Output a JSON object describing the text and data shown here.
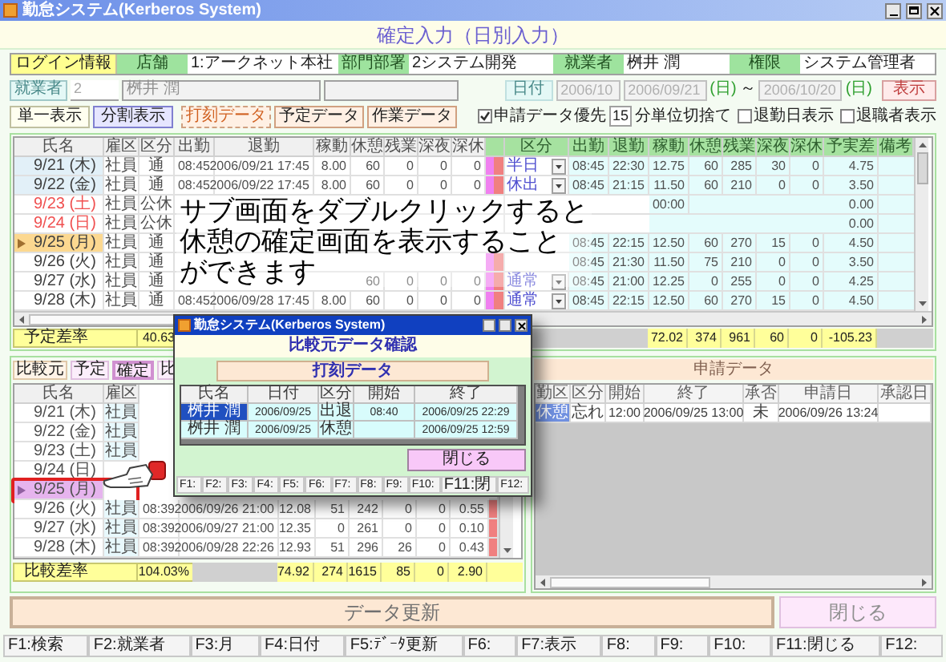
{
  "window": {
    "title": "勤怠システム(Kerberos System)"
  },
  "heading": "確定入力（日別入力）",
  "login_info": {
    "label": "ログイン情報",
    "fields": [
      {
        "label": "店舗",
        "value": "1:アークネット本社"
      },
      {
        "label": "部門部署",
        "value": "2システム開発"
      },
      {
        "label": "就業者",
        "value": "桝井 潤"
      },
      {
        "label": "権限",
        "value": "システム管理者"
      }
    ]
  },
  "filter": {
    "employee_button": "就業者",
    "employee_code": "2",
    "employee_name": "桝井 潤",
    "date_label": "日付",
    "month": "2006/10",
    "date_from": "2006/09/21",
    "weekday_from": "(日)",
    "range_sep": "～",
    "date_to": "2006/10/20",
    "weekday_to": "(日)",
    "show_button": "表示"
  },
  "view_buttons": [
    {
      "label": "単一表示",
      "selected": false
    },
    {
      "label": "分割表示",
      "selected": true
    }
  ],
  "data_buttons": [
    {
      "label": "打刻データ"
    },
    {
      "label": "予定データ"
    },
    {
      "label": "作業データ"
    }
  ],
  "options": [
    {
      "kind": "checkbox",
      "label": "申請データ優先",
      "checked": true
    },
    {
      "kind": "field",
      "value": "15"
    },
    {
      "kind": "text",
      "label": "分単位切捨て"
    },
    {
      "kind": "checkbox",
      "label": "退勤日表示",
      "checked": false
    },
    {
      "kind": "checkbox",
      "label": "退職者表示",
      "checked": false
    }
  ],
  "daily_table": {
    "columns": [
      {
        "label": "氏名",
        "kind": "name"
      },
      {
        "label": "雇区",
        "kind": "label"
      },
      {
        "label": "区分",
        "kind": "label"
      },
      {
        "label": "出勤",
        "kind": "number"
      },
      {
        "label": "退勤",
        "kind": "number"
      },
      {
        "label": "稼動",
        "kind": "number"
      },
      {
        "label": "休憩",
        "kind": "number"
      },
      {
        "label": "残業",
        "kind": "number"
      },
      {
        "label": "深夜",
        "kind": "number"
      },
      {
        "label": "深休",
        "kind": "number"
      },
      {
        "kind": "flags"
      },
      {
        "label": "区分",
        "kind": "select"
      },
      {
        "label": "出勤",
        "kind": "number"
      },
      {
        "label": "退勤",
        "kind": "number"
      },
      {
        "label": "稼動",
        "kind": "number"
      },
      {
        "label": "休憩",
        "kind": "number"
      },
      {
        "label": "残業",
        "kind": "number"
      },
      {
        "label": "深夜",
        "kind": "number"
      },
      {
        "label": "深休",
        "kind": "number"
      },
      {
        "label": "予実差",
        "kind": "number"
      },
      {
        "label": "備考",
        "kind": "number"
      }
    ],
    "rows": [
      {
        "selected": false,
        "holiday": false,
        "shaded": true,
        "flags": true,
        "cells": [
          "9/21 (木)",
          "社員",
          "通",
          "08:45",
          "2006/09/21 17:45",
          "8.00",
          "60",
          "0",
          "0",
          "0",
          null,
          "半日",
          "08:45",
          "22:30",
          "12.75",
          "60",
          "285",
          "30",
          "0",
          "4.75",
          null
        ]
      },
      {
        "selected": false,
        "holiday": false,
        "shaded": true,
        "flags": true,
        "cells": [
          "9/22 (金)",
          "社員",
          "通",
          "08:45",
          "2006/09/22 17:45",
          "8.00",
          "60",
          "0",
          "0",
          "0",
          null,
          "休出",
          "08:45",
          "21:15",
          "11.50",
          "60",
          "210",
          "0",
          "0",
          "3.50",
          null
        ]
      },
      {
        "selected": false,
        "holiday": true,
        "shaded": false,
        "flags": false,
        "cells": [
          "9/23 (土)",
          "社員",
          "公休",
          null,
          null,
          null,
          null,
          null,
          null,
          null,
          null,
          null,
          null,
          null,
          "00:00",
          null,
          null,
          null,
          null,
          "0.00",
          null
        ]
      },
      {
        "selected": false,
        "holiday": true,
        "shaded": false,
        "flags": false,
        "cells": [
          "9/24 (日)",
          "社員",
          "公休",
          null,
          null,
          null,
          null,
          null,
          null,
          null,
          null,
          null,
          null,
          null,
          null,
          null,
          null,
          null,
          null,
          "0.00",
          null
        ]
      },
      {
        "selected": true,
        "holiday": false,
        "cells": [
          "9/25 (月)",
          "社員",
          "通",
          null,
          null,
          null,
          null,
          null,
          null,
          null,
          null,
          null,
          "08:45",
          "22:15",
          "12.50",
          "60",
          "270",
          "15",
          "0",
          "4.50",
          null
        ]
      },
      {
        "selected": false,
        "holiday": false,
        "shaded": false,
        "flags": true,
        "cells": [
          "9/26 (火)",
          "社員",
          "通",
          null,
          null,
          null,
          null,
          null,
          null,
          null,
          null,
          null,
          "08:45",
          "21:30",
          "11.50",
          "75",
          "210",
          "0",
          "0",
          "3.50",
          null
        ]
      },
      {
        "selected": false,
        "holiday": false,
        "shaded": false,
        "flags": true,
        "cells": [
          "9/27 (水)",
          "社員",
          "通",
          null,
          null,
          null,
          "60",
          "0",
          "0",
          "0",
          null,
          "通常",
          "08:45",
          "21:00",
          "12.25",
          "0",
          "255",
          "0",
          "0",
          "4.25",
          null
        ]
      },
      {
        "selected": false,
        "holiday": false,
        "shaded": false,
        "flags": true,
        "cells": [
          "9/28 (木)",
          "社員",
          "通",
          "08:45",
          "2006/09/28 17:45",
          "8.00",
          "60",
          "0",
          "0",
          "0",
          null,
          "通常",
          "08:45",
          "22:15",
          "12.50",
          "60",
          "270",
          "15",
          "0",
          "4.50",
          null
        ]
      }
    ],
    "summary": {
      "label": "予定差率",
      "rate": "40.63",
      "totals": [
        "72.02",
        "374",
        "961",
        "60",
        "0",
        "-105.23"
      ]
    }
  },
  "compare": {
    "label": "比較元",
    "tabs": [
      {
        "label": "予定",
        "selected": false
      },
      {
        "label": "確定",
        "selected": true
      },
      {
        "label": "比",
        "selected": false
      }
    ],
    "columns": [
      {
        "label": "氏名",
        "kind": "name"
      },
      {
        "label": "雇区",
        "kind": "label"
      },
      {
        "kind": "number"
      },
      {
        "kind": "number"
      },
      {
        "kind": "number"
      },
      {
        "kind": "number"
      },
      {
        "kind": "number"
      },
      {
        "kind": "number"
      },
      {
        "kind": "number"
      },
      {
        "kind": "number"
      },
      {
        "kind": "flags"
      }
    ],
    "rows": [
      {
        "selected": false,
        "cells": [
          "9/21 (木)",
          "社員",
          null,
          null,
          null,
          null,
          null,
          null,
          null,
          null,
          null
        ]
      },
      {
        "selected": false,
        "cells": [
          "9/22 (金)",
          "社員",
          null,
          null,
          null,
          null,
          null,
          null,
          null,
          null,
          null
        ]
      },
      {
        "selected": false,
        "cells": [
          "9/23 (土)",
          "社員",
          null,
          null,
          null,
          null,
          null,
          null,
          null,
          null,
          null
        ]
      },
      {
        "selected": false,
        "cells": [
          "9/24 (日)",
          null,
          null,
          null,
          null,
          null,
          null,
          null,
          null,
          null,
          null
        ]
      },
      {
        "selected": true,
        "cells": [
          "9/25 (月)",
          null,
          null,
          null,
          null,
          null,
          null,
          null,
          null,
          null,
          null
        ]
      },
      {
        "selected": false,
        "flags": true,
        "cells": [
          "9/26 (火)",
          "社員",
          "08:39",
          "2006/09/26 21:00",
          "12.08",
          "51",
          "242",
          "0",
          "0",
          "0.55",
          null
        ]
      },
      {
        "selected": false,
        "flags": true,
        "cells": [
          "9/27 (水)",
          "社員",
          "08:39",
          "2006/09/27 21:00",
          "12.35",
          "0",
          "261",
          "0",
          "0",
          "0.10",
          null
        ]
      },
      {
        "selected": false,
        "flags": true,
        "cells": [
          "9/28 (木)",
          "社員",
          "08:39",
          "2006/09/28 22:26",
          "12.93",
          "51",
          "296",
          "26",
          "0",
          "0.43",
          null
        ]
      }
    ],
    "summary": {
      "label": "比較差率",
      "rate": "104.03%",
      "totals": [
        "74.92",
        "274",
        "1615",
        "85",
        "0",
        "2.90"
      ]
    }
  },
  "requests": {
    "title": "申請データ",
    "columns": [
      {
        "label": "勤区",
        "kind": "label"
      },
      {
        "label": "区分",
        "kind": "label"
      },
      {
        "label": "開始",
        "kind": "number"
      },
      {
        "label": "終了",
        "kind": "number"
      },
      {
        "label": "承否",
        "kind": "label"
      },
      {
        "label": "申請日",
        "kind": "number"
      },
      {
        "label": "承認日",
        "kind": "number"
      }
    ],
    "rows": [
      {
        "selected": true,
        "cells": [
          "休憩",
          "忘れ",
          "12:00",
          "2006/09/25 13:00",
          "未",
          "2006/09/26 13:24",
          null
        ]
      }
    ]
  },
  "dialog": {
    "title": "勤怠システム(Kerberos System)",
    "heading": "比較元データ確認",
    "subheading": "打刻データ",
    "columns": [
      {
        "label": "氏名",
        "kind": "label"
      },
      {
        "label": "日付",
        "kind": "number"
      },
      {
        "label": "区分",
        "kind": "label"
      },
      {
        "label": "開始",
        "kind": "number"
      },
      {
        "label": "終了",
        "kind": "number"
      }
    ],
    "rows": [
      {
        "selected": true,
        "cells": [
          "桝井 潤",
          "2006/09/25",
          "出退",
          "08:40",
          "2006/09/25 22:29"
        ]
      },
      {
        "selected": false,
        "cells": [
          "桝井 潤",
          "2006/09/25",
          "休憩",
          null,
          "2006/09/25 12:59"
        ]
      }
    ],
    "close_button": "閉じる",
    "function_keys": [
      "F1:",
      "F2:",
      "F3:",
      "F4:",
      "F5:",
      "F6:",
      "F7:",
      "F8:",
      "F9:",
      "F10:",
      "F11:閉",
      "F12:"
    ]
  },
  "callout": [
    "サブ画面をダブルクリックすると",
    "休憩の確定画面を表示すること",
    "ができます"
  ],
  "footer": {
    "update_button": "データ更新",
    "close_button": "閉じる",
    "function_keys": [
      "F1:検索",
      "F2:就業者",
      "F3:月",
      "F4:日付",
      "F5:ﾃﾞｰﾀ更新",
      "F6:",
      "F7:表示",
      "F8:",
      "F9:",
      "F10:",
      "F11:閉じる",
      "F12:"
    ]
  }
}
